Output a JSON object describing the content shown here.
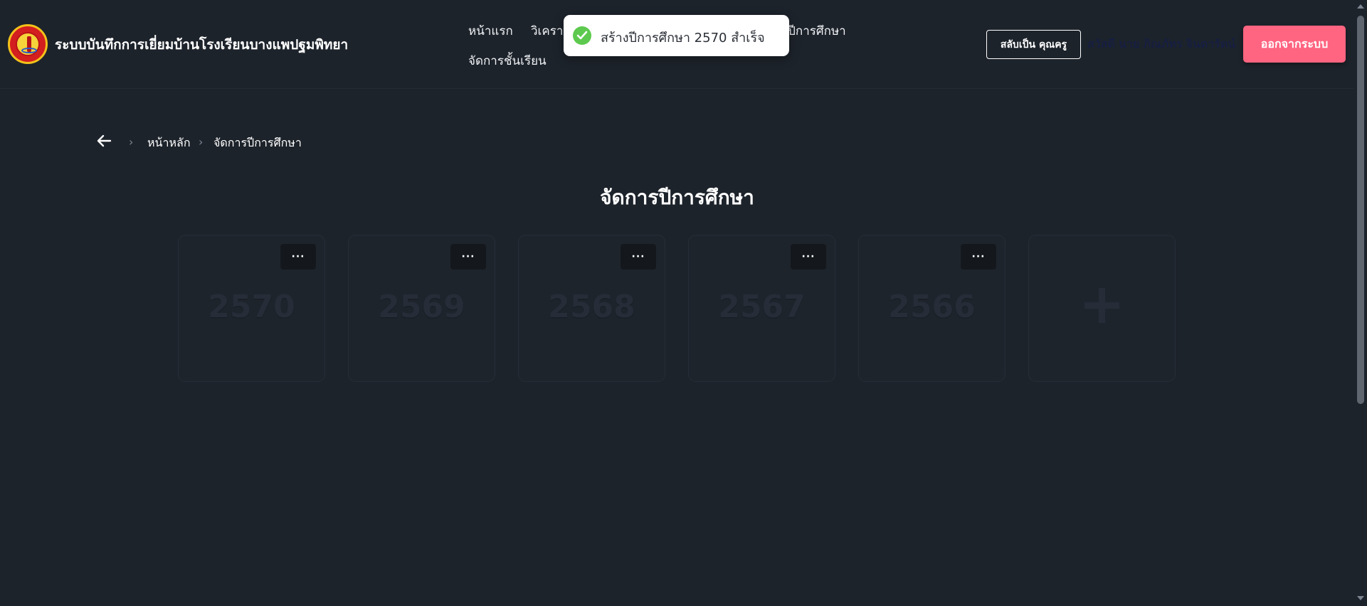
{
  "header": {
    "site_title": "ระบบบันทึกการเยี่ยมบ้านโรงเรียนบางแพปฐมพิทยา",
    "nav": {
      "home": "หน้าแรก",
      "analysis": "วิเคราะ",
      "academic_year": "รปีการศึกษา",
      "classroom": "จัดการชั้นเรียน"
    },
    "switch_role_label": "สลับเป็น คุณครู",
    "greeting": "สวัสดี นาย ภิณภัทร จินดารัตน์",
    "logout_label": "ออกจากระบบ"
  },
  "toast": {
    "message": "สร้างปีการศึกษา 2570 สำเร็จ",
    "icon": "check-circle-icon",
    "color": "#5dc94e"
  },
  "breadcrumb": {
    "home": "หน้าหลัก",
    "current": "จัดการปีการศึกษา"
  },
  "page_title": "จัดการปีการศึกษา",
  "cards": {
    "menu_label": "···",
    "add_label": "+",
    "years": [
      "2570",
      "2569",
      "2568",
      "2567",
      "2566"
    ]
  },
  "colors": {
    "background": "#1d232b",
    "logout_button": "#ff6480",
    "card_border": "#262d37"
  }
}
